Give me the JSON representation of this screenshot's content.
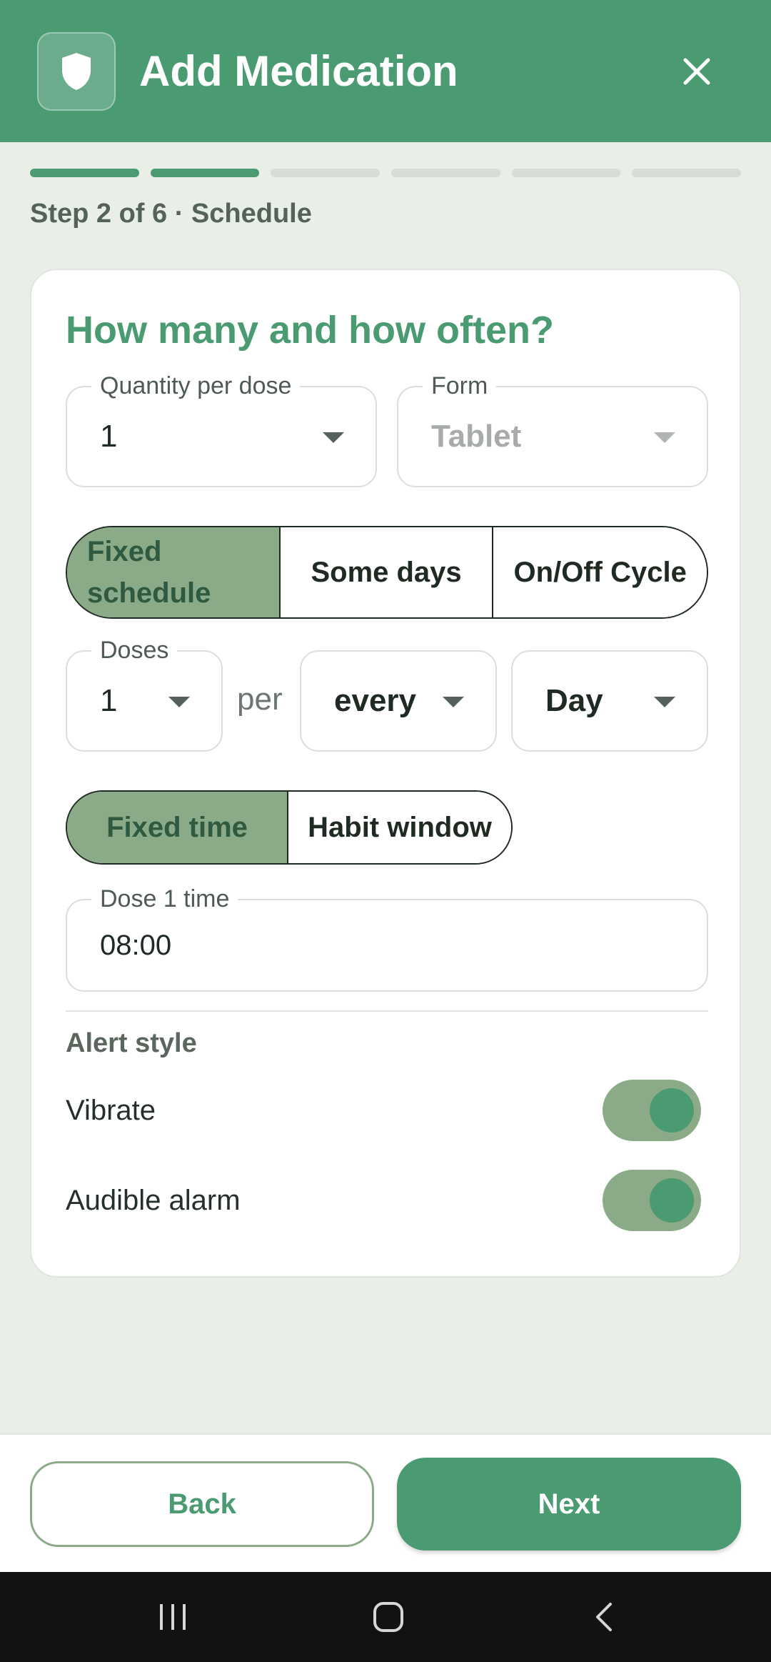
{
  "header": {
    "title": "Add Medication",
    "icon": "shield-icon",
    "close_icon": "close-icon",
    "color": "#4a9a72"
  },
  "progress": {
    "current_step": 2,
    "total_steps": 6,
    "label": "Step 2 of 6 · Schedule"
  },
  "card": {
    "title": "How many and how often?",
    "quantity": {
      "label": "Quantity per dose",
      "value": "1"
    },
    "form": {
      "label": "Form",
      "value": "Tablet",
      "disabled": true
    },
    "schedule_type": {
      "options": [
        "Fixed\nschedule",
        "Some days",
        "On/Off Cycle"
      ],
      "selected": "Fixed schedule"
    },
    "doses": {
      "label": "Doses",
      "value": "1"
    },
    "per_text": "per",
    "frequency": {
      "value": "every"
    },
    "period": {
      "value": "Day"
    },
    "time_mode": {
      "options": [
        "Fixed time",
        "Habit window"
      ],
      "selected": "Fixed time"
    },
    "dose_time": {
      "label": "Dose 1 time",
      "value": "08:00"
    },
    "alert": {
      "title": "Alert style",
      "vibrate": {
        "label": "Vibrate",
        "on": true
      },
      "audible": {
        "label": "Audible alarm",
        "on": true
      }
    }
  },
  "footer": {
    "back_label": "Back",
    "next_label": "Next"
  },
  "system_nav": {
    "recents_icon": "recents-icon",
    "home_icon": "home-icon",
    "back_icon": "back-icon"
  },
  "colors": {
    "accent": "#4a9a72",
    "selected": "#8aaa88",
    "background": "#e9efe6"
  }
}
